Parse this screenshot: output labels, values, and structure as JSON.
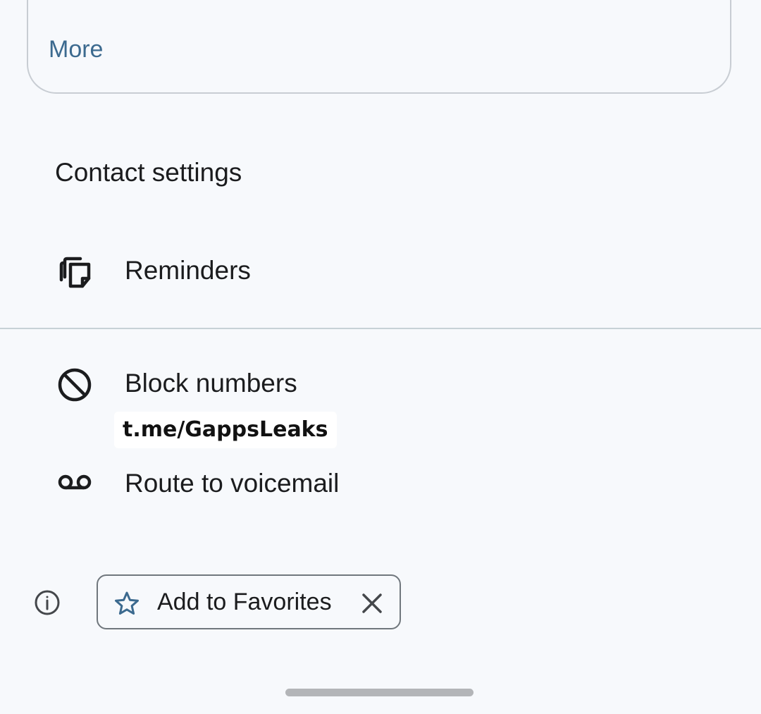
{
  "card": {
    "more_label": "More"
  },
  "contact_settings": {
    "title": "Contact settings",
    "items": [
      {
        "label": "Reminders",
        "icon": "reminders-icon"
      },
      {
        "label": "Block numbers",
        "icon": "block-icon"
      },
      {
        "label": "Route to voicemail",
        "icon": "voicemail-icon"
      }
    ]
  },
  "watermark": {
    "text": "t.me/GappsLeaks"
  },
  "favorites_chip": {
    "label": "Add to Favorites",
    "leading_icon": "star-icon",
    "trailing_icon": "close-icon"
  },
  "info": {
    "icon": "info-icon"
  },
  "colors": {
    "background": "#f7f9fc",
    "accent": "#3c6a8f",
    "text": "#1b1c1e",
    "divider": "#c7d2d6"
  }
}
